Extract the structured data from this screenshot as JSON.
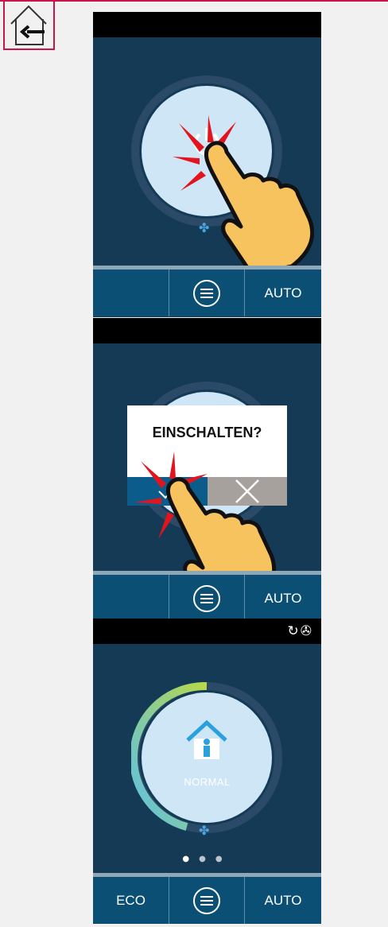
{
  "nav": {
    "home_back_icon": "home-back-arrow-icon"
  },
  "panels": [
    {
      "step": 1,
      "bottom_bar": {
        "left_label": "",
        "menu_icon": "menu-lines-icon",
        "right_label": "AUTO"
      },
      "gesture": "tap-hand-icon"
    },
    {
      "step": 2,
      "dialog": {
        "title": "EINSCHALTEN?",
        "confirm_icon": "check-icon",
        "cancel_icon": "close-icon"
      },
      "bottom_bar": {
        "left_label": "",
        "menu_icon": "menu-lines-icon",
        "right_label": "AUTO"
      },
      "gesture": "tap-hand-icon"
    },
    {
      "step": 3,
      "status_icons": [
        "refresh-icon",
        "fan-icon"
      ],
      "mode_label": "NORMAL",
      "mode_icon": "house-person-icon",
      "page_dots": 3,
      "active_dot": 1,
      "bottom_bar": {
        "left_label": "ECO",
        "menu_icon": "menu-lines-icon",
        "right_label": "AUTO"
      }
    }
  ],
  "colors": {
    "accent": "#c8164a",
    "panel_bg": "#143a55",
    "bar_bg": "#0b4f74",
    "dial_light": "#cfe6f7",
    "confirm": "#0b5c8a",
    "cancel": "#a6a19c",
    "tap_red": "#e3141e",
    "hand": "#f7c35f"
  }
}
